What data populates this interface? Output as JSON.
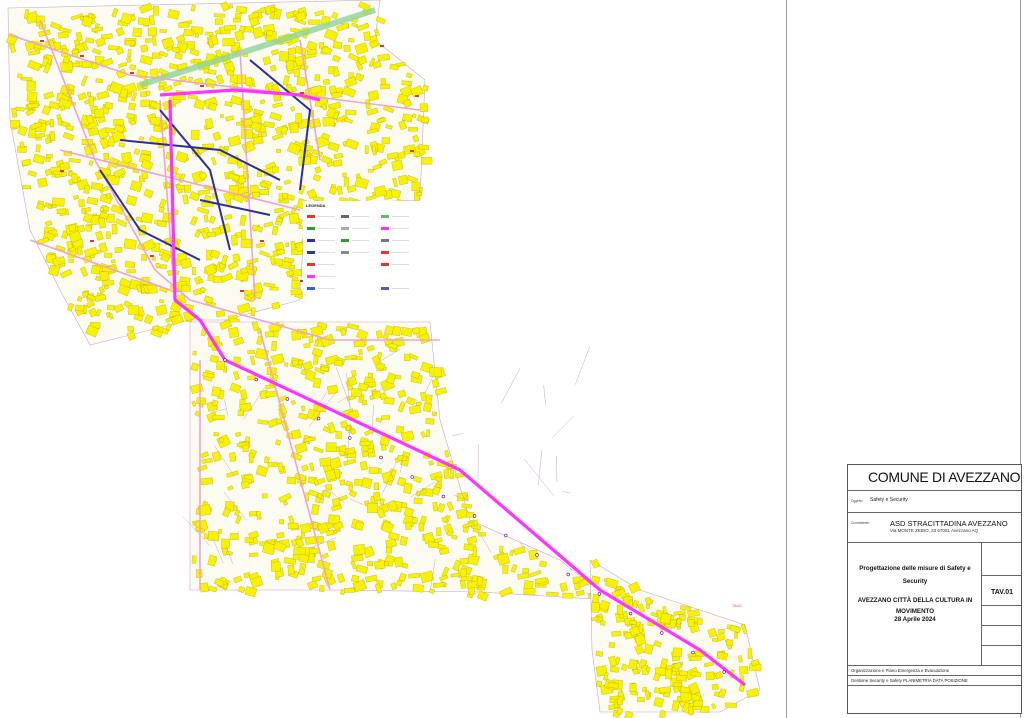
{
  "map": {
    "legend_title": "LEGENDA",
    "area_label": "TAV.01",
    "colors": {
      "buildings": "#f7f300",
      "roads": "#f2a3cc",
      "route": "#ff33ff",
      "security_route": "#2b2e9e",
      "barrier": "#e8342c",
      "parcel_lines": "#c8a6c8",
      "rail": "#8fd39a"
    },
    "legend_items": [
      {
        "icon": "red-line-swatch",
        "label": "Barriera"
      },
      {
        "icon": "green-box-swatch",
        "label": "Area verde"
      },
      {
        "icon": "blue-line-swatch",
        "label": "Percorso"
      },
      {
        "icon": "parking-sign-icon",
        "label": "Parcheggio"
      },
      {
        "icon": "no-entry-sign-icon",
        "label": "Divieto"
      },
      {
        "icon": "pink-line-swatch",
        "label": "Tracciato"
      }
    ]
  },
  "title_block": {
    "comune": "COMUNE DI AVEZZANO",
    "subject_label": "Oggetto:",
    "subject": "Safety e Security",
    "client_label": "Committente:",
    "client_name": "ASD STRACITTADINA AVEZZANO",
    "client_address": "Via MONTE ZEBIO, 33 67051 Avezzano AQ",
    "project_title": "Progettazione delle misure di Safety e Security",
    "event_title": "AVEZZANO CITTÀ DELLA CULTURA IN MOVIMENTO",
    "event_date": "28 Aprile 2024",
    "table_no": "TAV.01",
    "org_line_1": "Organizzazione e Piano Emergenza e Evacuazione",
    "org_line_2": "Gestione Security e Safety PLANIMETRIA DATA POSIZIONE"
  }
}
